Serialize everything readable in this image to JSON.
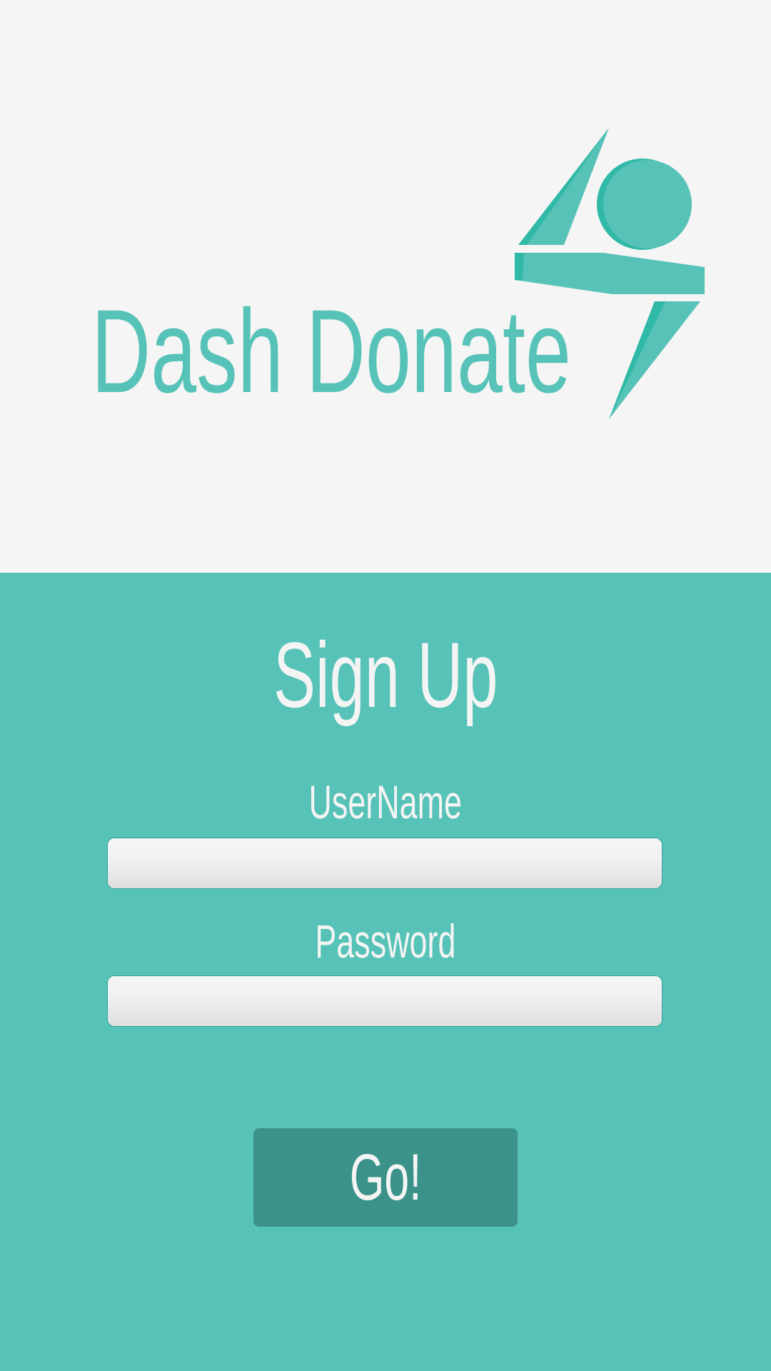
{
  "app": {
    "title": "Dash Donate"
  },
  "colors": {
    "brand": "#57c2b7",
    "brand_dark": "#2fb9a6",
    "button": "#3a9288",
    "background": "#f5f5f5"
  },
  "form": {
    "heading": "Sign Up",
    "username_label": "UserName",
    "username_value": "",
    "password_label": "Password",
    "password_value": "",
    "submit_label": "Go!"
  }
}
